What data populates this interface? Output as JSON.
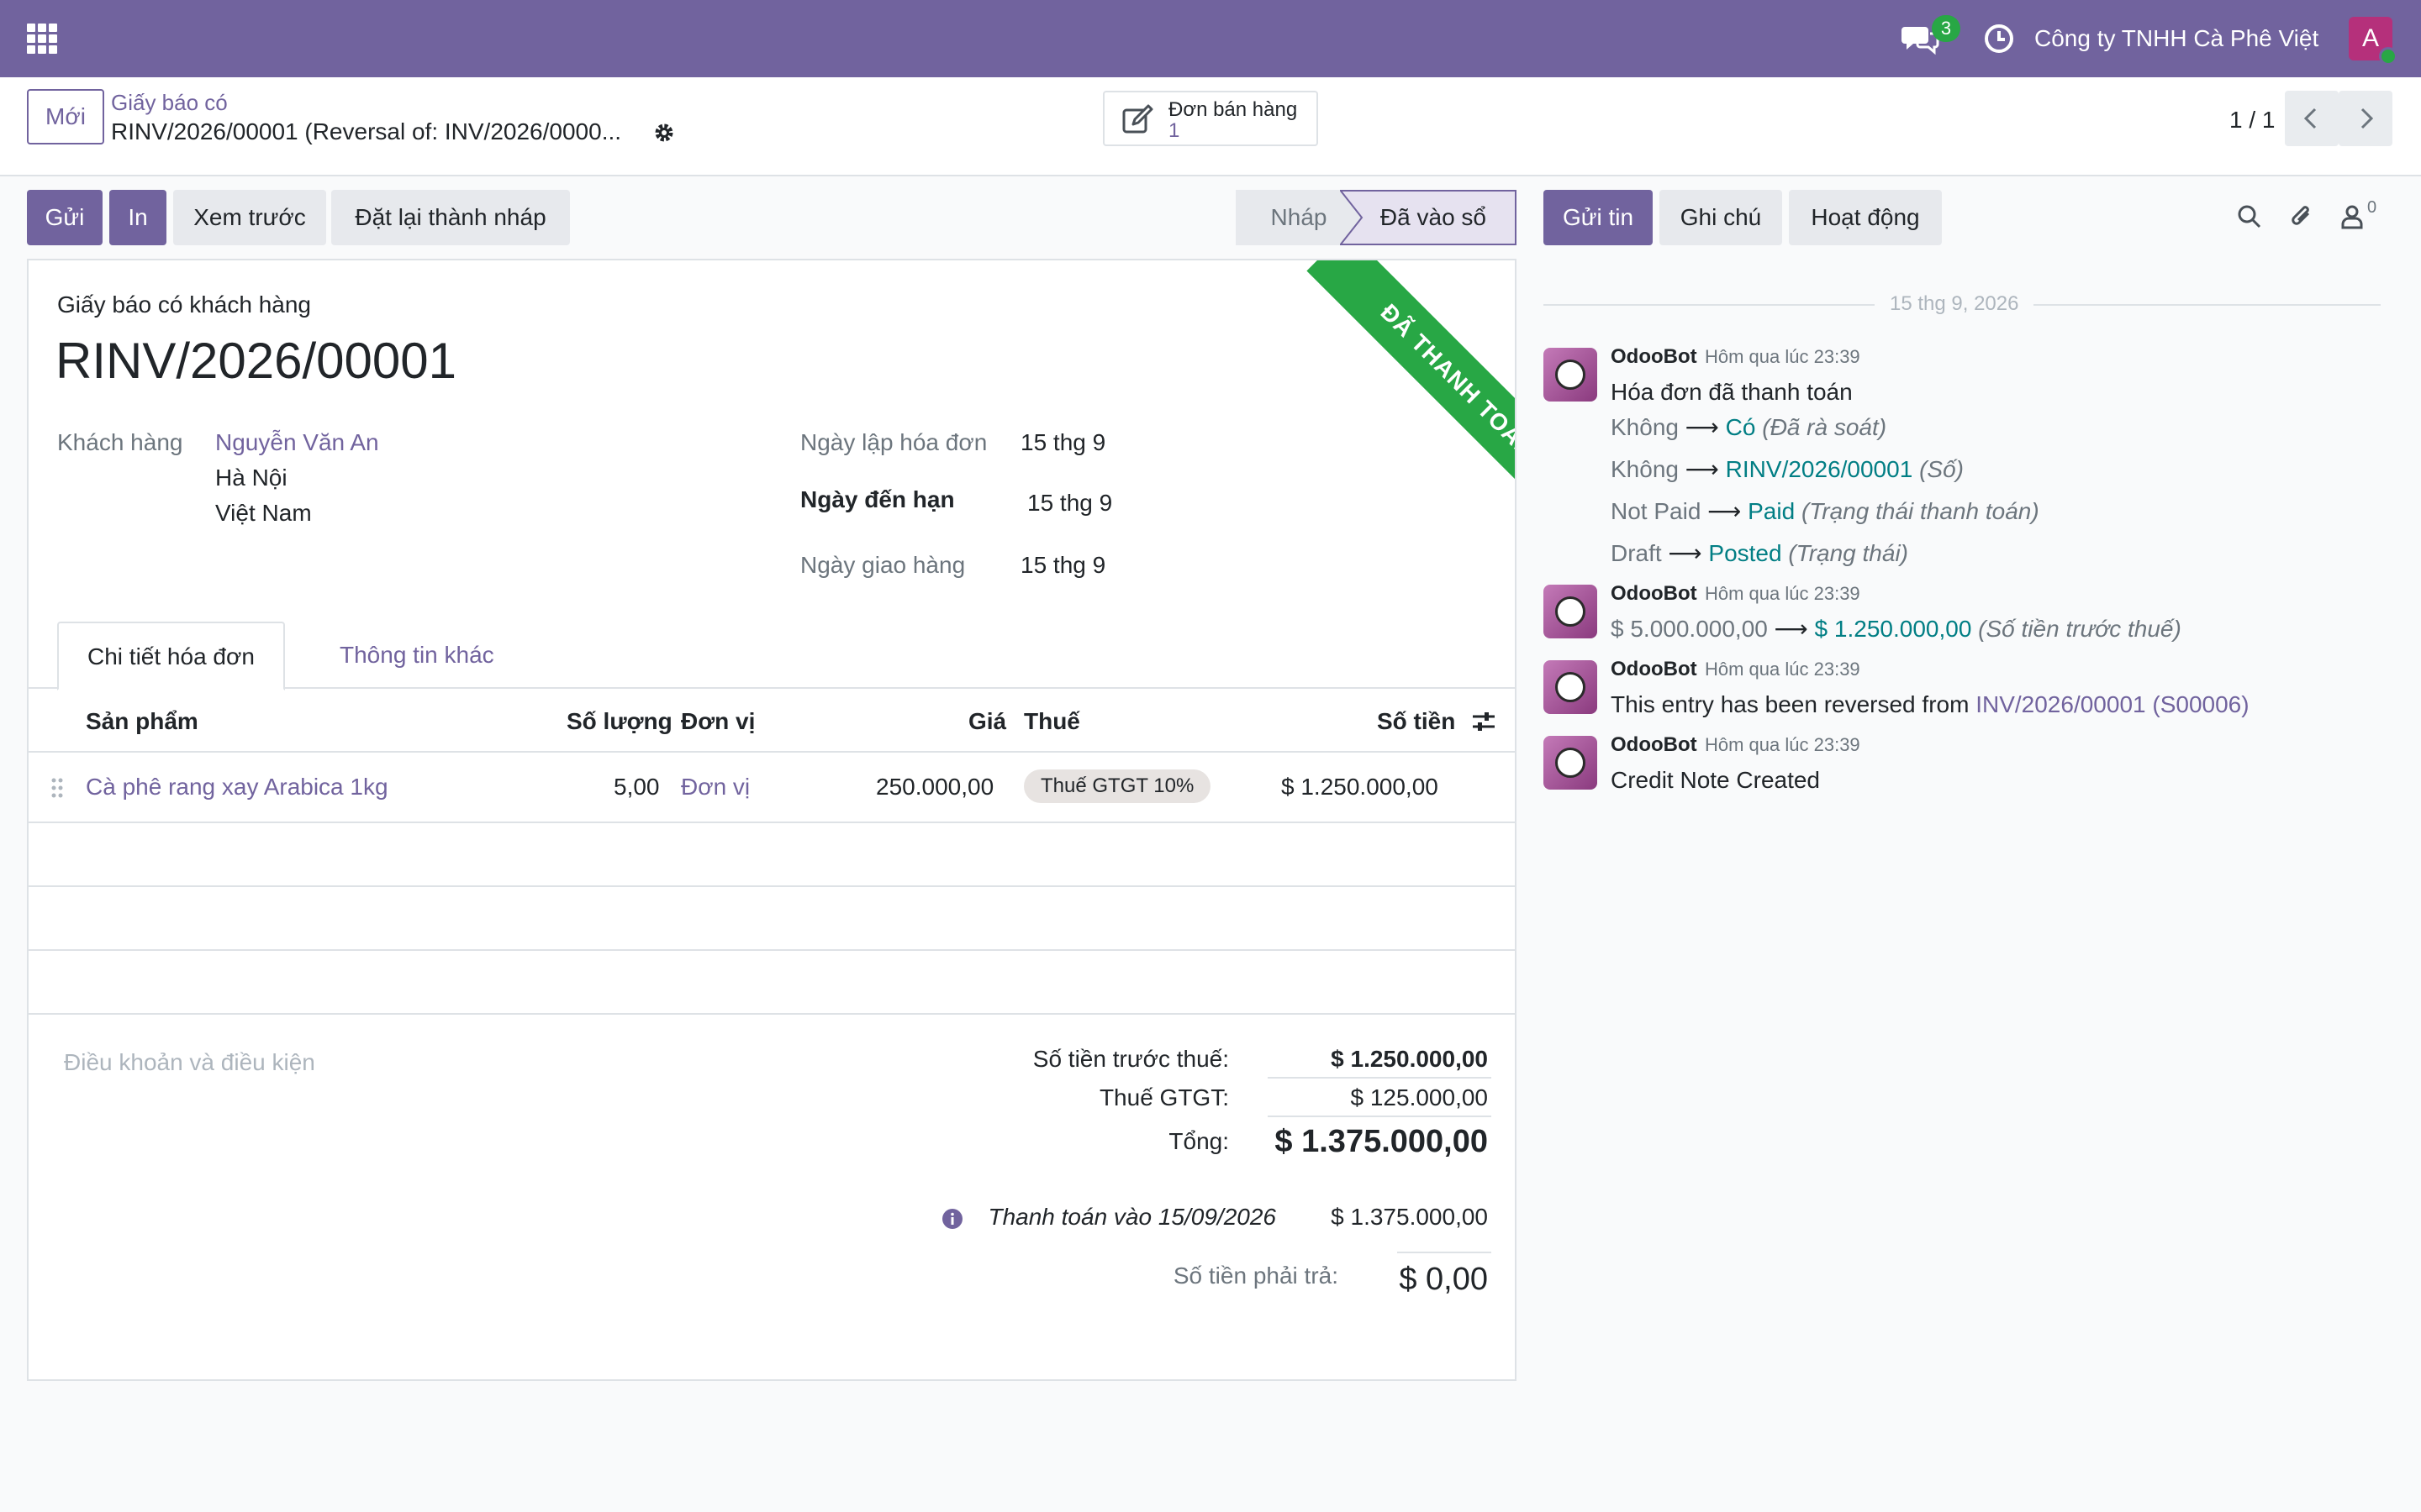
{
  "navbar": {
    "company": "Công ty TNHH Cà Phê Việt",
    "message_count": "3",
    "user_initial": "A",
    "colors": {
      "bar": "#71639e",
      "avatar": "#b5307b",
      "badge": "#28a745"
    }
  },
  "control_panel": {
    "new_button": "Mới",
    "breadcrumb_parent": "Giấy báo có",
    "breadcrumb_current": "RINV/2026/00001 (Reversal of: INV/2026/0000...",
    "smart_button": {
      "label": "Đơn bán hàng",
      "count": "1"
    },
    "pager": "1 / 1"
  },
  "actions": {
    "send": "Gửi",
    "print": "In",
    "preview": "Xem trước",
    "reset_to_draft": "Đặt lại thành nháp"
  },
  "status": {
    "draft": "Nháp",
    "posted": "Đã vào sổ"
  },
  "form": {
    "ribbon": "ĐÃ THANH TOÁN",
    "doc_type": "Giấy báo có khách hàng",
    "doc_name": "RINV/2026/00001",
    "customer_label": "Khách hàng",
    "customer_name": "Nguyễn Văn An",
    "customer_city": "Hà Nội",
    "customer_country": "Việt Nam",
    "invoice_date_label": "Ngày lập hóa đơn",
    "invoice_date": "15 thg 9",
    "due_date_label": "Ngày đến hạn",
    "due_date": "15 thg 9",
    "delivery_date_label": "Ngày giao hàng",
    "delivery_date": "15 thg 9",
    "tabs": [
      "Chi tiết hóa đơn",
      "Thông tin khác"
    ],
    "columns": {
      "product": "Sản phẩm",
      "quantity": "Số lượng",
      "uom": "Đơn vị",
      "price": "Giá",
      "tax": "Thuế",
      "amount": "Số tiền"
    },
    "lines": [
      {
        "product": "Cà phê rang xay Arabica 1kg",
        "quantity": "5,00",
        "uom": "Đơn vị",
        "price": "250.000,00",
        "tax": "Thuế GTGT 10%",
        "amount": "$ 1.250.000,00"
      }
    ],
    "terms_placeholder": "Điều khoản và điều kiện",
    "totals": {
      "untaxed_label": "Số tiền trước thuế:",
      "untaxed": "$ 1.250.000,00",
      "vat_label": "Thuế GTGT:",
      "vat": "$ 125.000,00",
      "total_label": "Tổng:",
      "total": "$ 1.375.000,00",
      "payment_label": "Thanh toán vào 15/09/2026",
      "payment": "$ 1.375.000,00",
      "due_label": "Số tiền phải trả:",
      "due": "$ 0,00"
    }
  },
  "chatter": {
    "send_message": "Gửi tin",
    "log_note": "Ghi chú",
    "activities": "Hoạt động",
    "followers": "0",
    "date_separator": "15 thg 9, 2026",
    "messages": [
      {
        "author": "OdooBot",
        "time": "Hôm qua lúc 23:39",
        "title": "Hóa đơn đã thanh toán",
        "changes": [
          {
            "old": "Không",
            "new": "Có",
            "field": "(Đã rà soát)"
          },
          {
            "old": "Không",
            "new": "RINV/2026/00001",
            "field": "(Số)"
          },
          {
            "old": "Not Paid",
            "new": "Paid",
            "field": "(Trạng thái thanh toán)"
          },
          {
            "old": "Draft",
            "new": "Posted",
            "field": "(Trạng thái)"
          }
        ]
      },
      {
        "author": "OdooBot",
        "time": "Hôm qua lúc 23:39",
        "changes": [
          {
            "old": "$ 5.000.000,00",
            "new": "$ 1.250.000,00",
            "field": "(Số tiền trước thuế)"
          }
        ]
      },
      {
        "author": "OdooBot",
        "time": "Hôm qua lúc 23:39",
        "text": "This entry has been reversed from",
        "link": "INV/2026/00001 (S00006)"
      },
      {
        "author": "OdooBot",
        "time": "Hôm qua lúc 23:39",
        "text": "Credit Note Created"
      }
    ]
  }
}
